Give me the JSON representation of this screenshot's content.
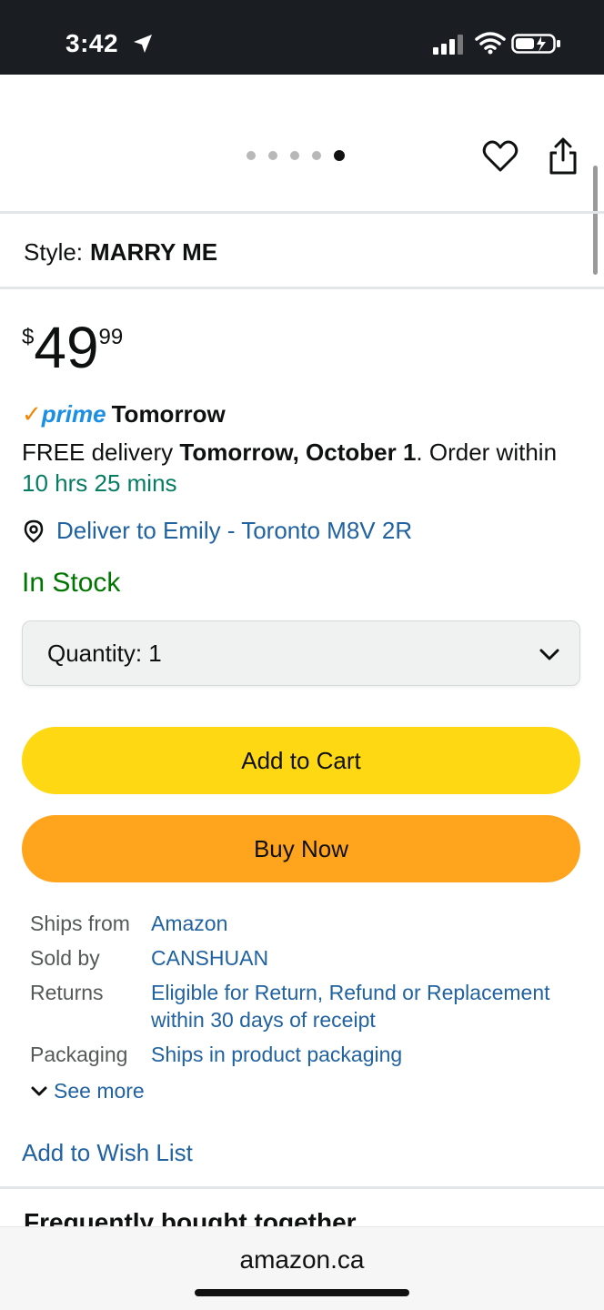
{
  "status_bar": {
    "time": "3:42"
  },
  "carousel": {
    "dot_count": 5,
    "active_index": 4
  },
  "product": {
    "style_label": "Style:",
    "style_value": "MARRY ME",
    "price_symbol": "$",
    "price_whole": "49",
    "price_fraction": "99",
    "prime_check": "✓",
    "prime_word": "prime",
    "prime_day": "Tomorrow",
    "delivery_prefix": "FREE delivery ",
    "delivery_date": "Tomorrow, October 1",
    "delivery_mid": ". Order within ",
    "delivery_countdown": "10 hrs 25 mins",
    "deliver_to": "Deliver to Emily - Toronto M8V 2R",
    "stock_status": "In Stock"
  },
  "quantity": {
    "label": "Quantity:",
    "value": "1"
  },
  "buttons": {
    "add_to_cart": "Add to Cart",
    "buy_now": "Buy Now"
  },
  "details": [
    {
      "label": "Ships from",
      "value": "Amazon"
    },
    {
      "label": "Sold by",
      "value": "CANSHUAN"
    },
    {
      "label": "Returns",
      "value": "Eligible for Return, Refund or Replacement within 30 days of receipt"
    },
    {
      "label": "Packaging",
      "value": "Ships in product packaging"
    }
  ],
  "see_more": "See more",
  "wish_list": "Add to Wish List",
  "frequently_bought": "Frequently bought together",
  "browser": {
    "url": "amazon.ca"
  },
  "colors": {
    "link": "#2162a1",
    "green": "#067d62",
    "in_stock": "#007600",
    "cart_button": "#ffd814",
    "buy_button": "#ffa41c",
    "prime_blue": "#1a8fe3",
    "prime_check": "#f08804"
  }
}
